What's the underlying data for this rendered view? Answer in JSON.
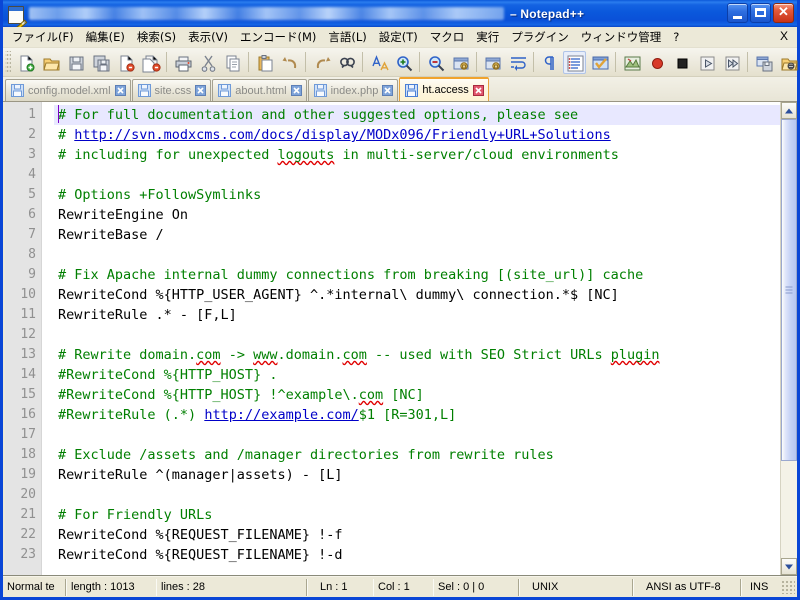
{
  "window": {
    "title_suffix": "– Notepad++",
    "title_redacted": true,
    "app_icon": "notepad-plus-plus-icon",
    "buttons": {
      "minimize": "minimize",
      "maximize": "maximize",
      "close": "close"
    }
  },
  "menu": {
    "items": [
      "ファイル(F)",
      "編集(E)",
      "検索(S)",
      "表示(V)",
      "エンコード(M)",
      "言語(L)",
      "設定(T)",
      "マクロ",
      "実行",
      "プラグイン",
      "ウィンドウ管理",
      "?"
    ],
    "close_document": "X"
  },
  "toolbar": {
    "buttons": [
      "new-file-icon",
      "open-file-icon",
      "save-icon",
      "save-all-icon",
      "close-file-icon",
      "close-all-files-icon",
      "print-icon",
      "cut-icon",
      "copy-icon",
      "paste-icon",
      "undo-icon",
      "redo-icon",
      "find-icon",
      "replace-icon",
      "zoom-in-icon",
      "zoom-out-icon",
      "sync-vertical-scroll-icon",
      "sync-horizontal-scroll-icon",
      "word-wrap-icon",
      "show-all-characters-icon",
      "indent-guide-icon",
      "user-defined-dialog-icon",
      "document-map-icon",
      "record-macro-icon",
      "stop-recording-macro-icon",
      "play-macro-icon",
      "run-macro-multiple-icon",
      "save-macro-icon",
      "run-icon"
    ]
  },
  "tabs": [
    {
      "label": "config.model.xml",
      "active": false,
      "icon": "save-disk-icon",
      "close": "close-tab-icon"
    },
    {
      "label": "site.css",
      "active": false,
      "icon": "save-disk-icon",
      "close": "close-tab-icon"
    },
    {
      "label": "about.html",
      "active": false,
      "icon": "save-disk-icon",
      "close": "close-tab-icon"
    },
    {
      "label": "index.php",
      "active": false,
      "icon": "save-disk-icon",
      "close": "close-tab-icon"
    },
    {
      "label": "ht.access",
      "active": true,
      "icon": "save-disk-icon",
      "close": "close-tab-icon"
    }
  ],
  "editor": {
    "first_visible_line": 1,
    "caret_line": 1,
    "lines": [
      {
        "n": 1,
        "segs": [
          {
            "t": "# For full documentation and other suggested options, please see",
            "c": "cmt"
          }
        ],
        "current": true
      },
      {
        "n": 2,
        "segs": [
          {
            "t": "# ",
            "c": "cmt"
          },
          {
            "t": "http://svn.modxcms.com/docs/display/MODx096/Friendly+URL+Solutions",
            "c": "lnk"
          }
        ]
      },
      {
        "n": 3,
        "segs": [
          {
            "t": "# including for unexpected ",
            "c": "cmt"
          },
          {
            "t": "logouts",
            "c": "cmt sp"
          },
          {
            "t": " in multi-server/cloud environments",
            "c": "cmt"
          }
        ]
      },
      {
        "n": 4,
        "segs": []
      },
      {
        "n": 5,
        "segs": [
          {
            "t": "# Options +FollowSymlinks",
            "c": "cmt"
          }
        ]
      },
      {
        "n": 6,
        "segs": [
          {
            "t": "RewriteEngine On",
            "c": ""
          }
        ]
      },
      {
        "n": 7,
        "segs": [
          {
            "t": "RewriteBase /",
            "c": ""
          }
        ]
      },
      {
        "n": 8,
        "segs": []
      },
      {
        "n": 9,
        "segs": [
          {
            "t": "# Fix Apache internal dummy connections from breaking [(site_url)] cache",
            "c": "cmt"
          }
        ]
      },
      {
        "n": 10,
        "segs": [
          {
            "t": "RewriteCond %{HTTP_USER_AGENT} ^.*internal\\ dummy\\ connection.*$ [NC]",
            "c": ""
          }
        ]
      },
      {
        "n": 11,
        "segs": [
          {
            "t": "RewriteRule .* - [F,L]",
            "c": ""
          }
        ]
      },
      {
        "n": 12,
        "segs": []
      },
      {
        "n": 13,
        "segs": [
          {
            "t": "# Rewrite domain.",
            "c": "cmt"
          },
          {
            "t": "com",
            "c": "cmt sp"
          },
          {
            "t": " -> ",
            "c": "cmt"
          },
          {
            "t": "www",
            "c": "cmt sp"
          },
          {
            "t": ".domain.",
            "c": "cmt"
          },
          {
            "t": "com",
            "c": "cmt sp"
          },
          {
            "t": " -- used with SEO Strict URLs ",
            "c": "cmt"
          },
          {
            "t": "plugin",
            "c": "cmt sp"
          }
        ]
      },
      {
        "n": 14,
        "segs": [
          {
            "t": "#RewriteCond %{HTTP_HOST} .",
            "c": "cmt"
          }
        ]
      },
      {
        "n": 15,
        "segs": [
          {
            "t": "#RewriteCond %{HTTP_HOST} !^example\\.",
            "c": "cmt"
          },
          {
            "t": "com",
            "c": "cmt sp"
          },
          {
            "t": " [NC]",
            "c": "cmt"
          }
        ]
      },
      {
        "n": 16,
        "segs": [
          {
            "t": "#RewriteRule (.*) ",
            "c": "cmt"
          },
          {
            "t": "http://example.com/",
            "c": "lnk"
          },
          {
            "t": "$1 [R=301,L]",
            "c": "cmt"
          }
        ]
      },
      {
        "n": 17,
        "segs": []
      },
      {
        "n": 18,
        "segs": [
          {
            "t": "# Exclude /assets and /manager directories from rewrite rules",
            "c": "cmt"
          }
        ]
      },
      {
        "n": 19,
        "segs": [
          {
            "t": "RewriteRule ^(manager|assets) - [L]",
            "c": ""
          }
        ]
      },
      {
        "n": 20,
        "segs": []
      },
      {
        "n": 21,
        "segs": [
          {
            "t": "# For Friendly URLs",
            "c": "cmt"
          }
        ]
      },
      {
        "n": 22,
        "segs": [
          {
            "t": "RewriteCond %{REQUEST_FILENAME} !-f",
            "c": ""
          }
        ]
      },
      {
        "n": 23,
        "segs": [
          {
            "t": "RewriteCond %{REQUEST_FILENAME} !-d",
            "c": ""
          }
        ]
      }
    ],
    "vscroll": {
      "thumb_top_pct": 0,
      "thumb_height_pct": 78
    }
  },
  "statusbar": {
    "doc_type": "Normal te",
    "length_label": "length : 1013",
    "lines_label": "lines : 28",
    "ln": "Ln : 1",
    "col": "Col : 1",
    "sel": "Sel : 0 | 0",
    "eol": "UNIX",
    "encoding": "ANSI as UTF-8",
    "insert_mode": "INS"
  },
  "colors": {
    "title_blue": "#0a58dc",
    "comment_green": "#007f00",
    "link_blue": "#0000c8",
    "spell_red": "#e00000",
    "active_tab_orange": "#f0a32e",
    "chrome": "#ece9d8"
  }
}
